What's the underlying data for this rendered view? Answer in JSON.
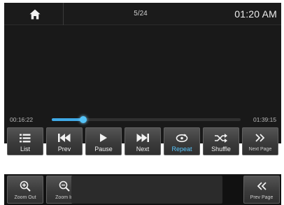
{
  "player": {
    "track_count": "5/24",
    "clock": "01:20 AM",
    "elapsed": "00:16:22",
    "total": "01:39:15",
    "progress_percent": 16.5
  },
  "controls": {
    "list": "List",
    "prev": "Prev",
    "pause": "Pause",
    "next": "Next",
    "repeat": "Repeat",
    "shuffle": "Shuffle",
    "next_page": "Next Page"
  },
  "page2": {
    "zoom_out": "Zoom Out",
    "zoom_in": "Zoom In",
    "prev_page": "Prev Page"
  },
  "colors": {
    "accent": "#3fa9e6",
    "active_label": "#5ac8ff"
  },
  "icons": [
    "home-icon",
    "list-icon",
    "prev-icon",
    "play-icon",
    "next-icon",
    "repeat-icon",
    "shuffle-icon",
    "next-page-icon",
    "zoom-out-icon",
    "zoom-in-icon",
    "prev-page-icon"
  ]
}
